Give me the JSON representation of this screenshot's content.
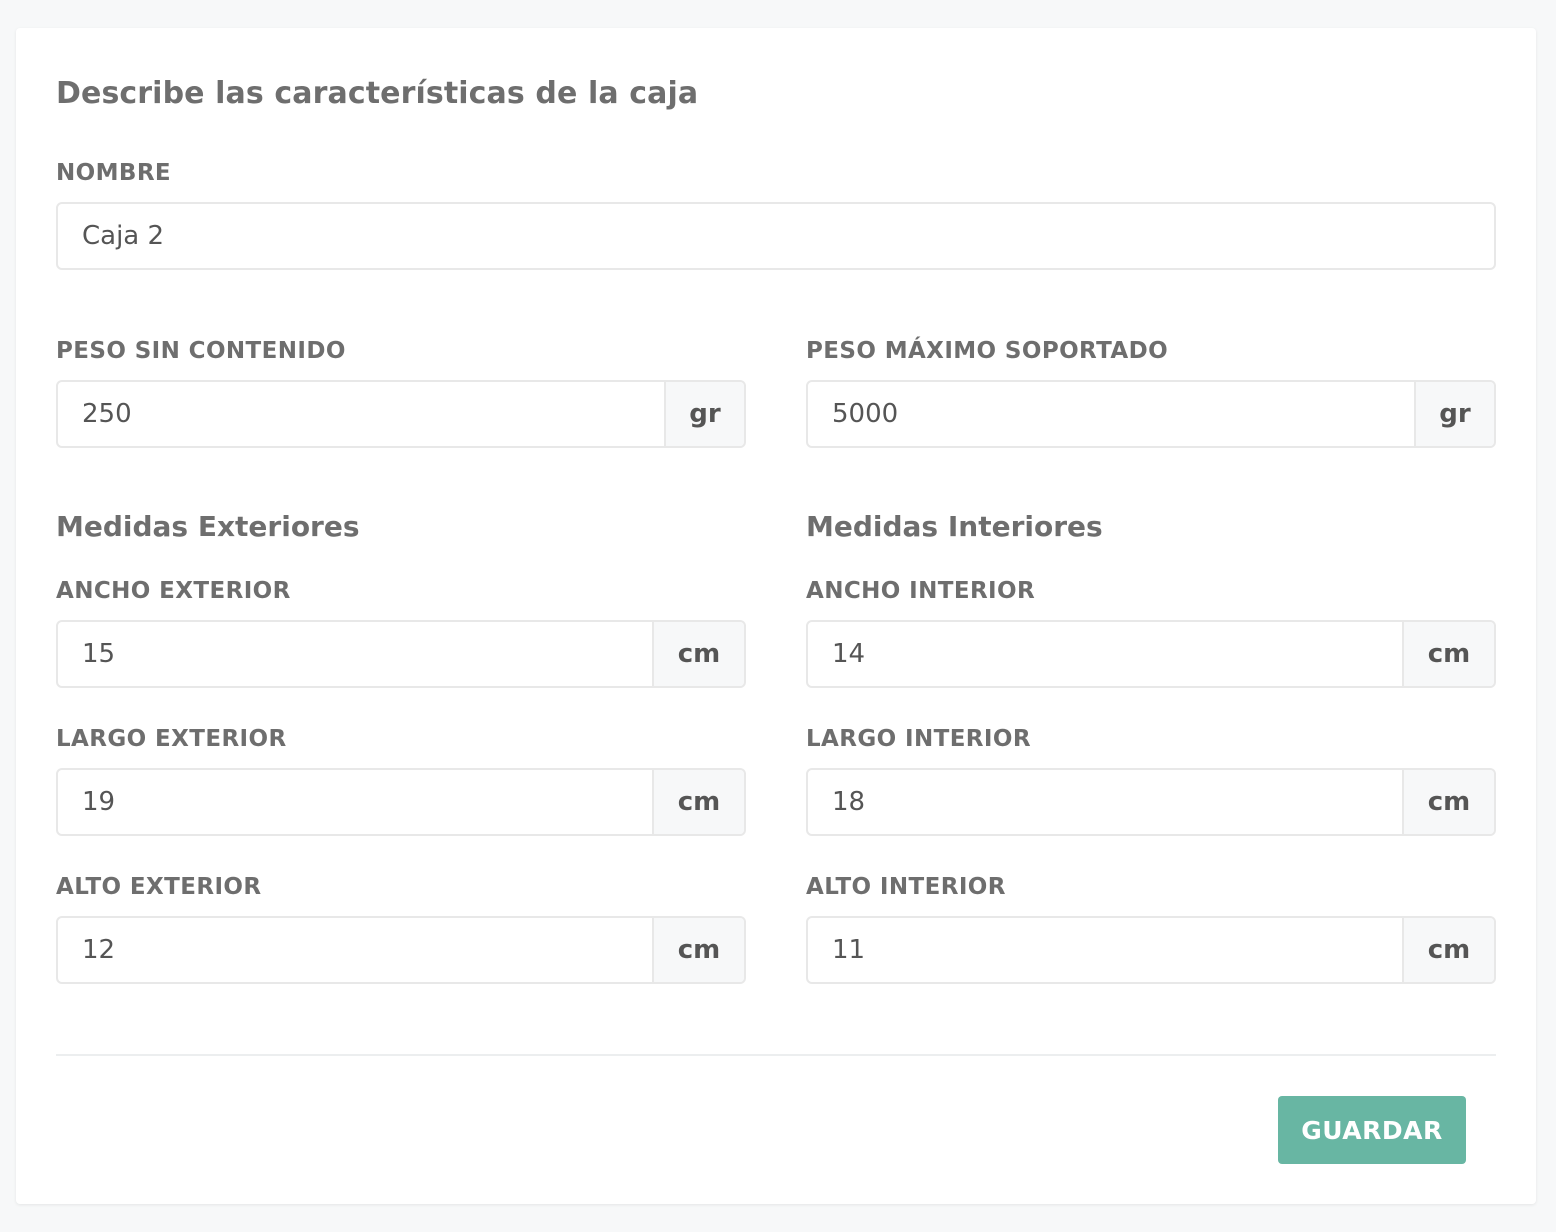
{
  "form": {
    "title": "Describe las características de la caja",
    "nombre": {
      "label": "NOMBRE",
      "value": "Caja 2"
    },
    "peso_sin_contenido": {
      "label": "PESO SIN CONTENIDO",
      "value": "250",
      "unit": "gr"
    },
    "peso_maximo": {
      "label": "PESO MÁXIMO SOPORTADO",
      "value": "5000",
      "unit": "gr"
    },
    "exteriores": {
      "title": "Medidas Exteriores",
      "ancho": {
        "label": "ANCHO EXTERIOR",
        "value": "15",
        "unit": "cm"
      },
      "largo": {
        "label": "LARGO EXTERIOR",
        "value": "19",
        "unit": "cm"
      },
      "alto": {
        "label": "ALTO EXTERIOR",
        "value": "12",
        "unit": "cm"
      }
    },
    "interiores": {
      "title": "Medidas Interiores",
      "ancho": {
        "label": "ANCHO INTERIOR",
        "value": "14",
        "unit": "cm"
      },
      "largo": {
        "label": "LARGO INTERIOR",
        "value": "18",
        "unit": "cm"
      },
      "alto": {
        "label": "ALTO INTERIOR",
        "value": "11",
        "unit": "cm"
      }
    },
    "save_label": "GUARDAR"
  },
  "colors": {
    "primary": "#68b6a3",
    "background": "#f7f8f9",
    "text": "#6e6e6e"
  }
}
